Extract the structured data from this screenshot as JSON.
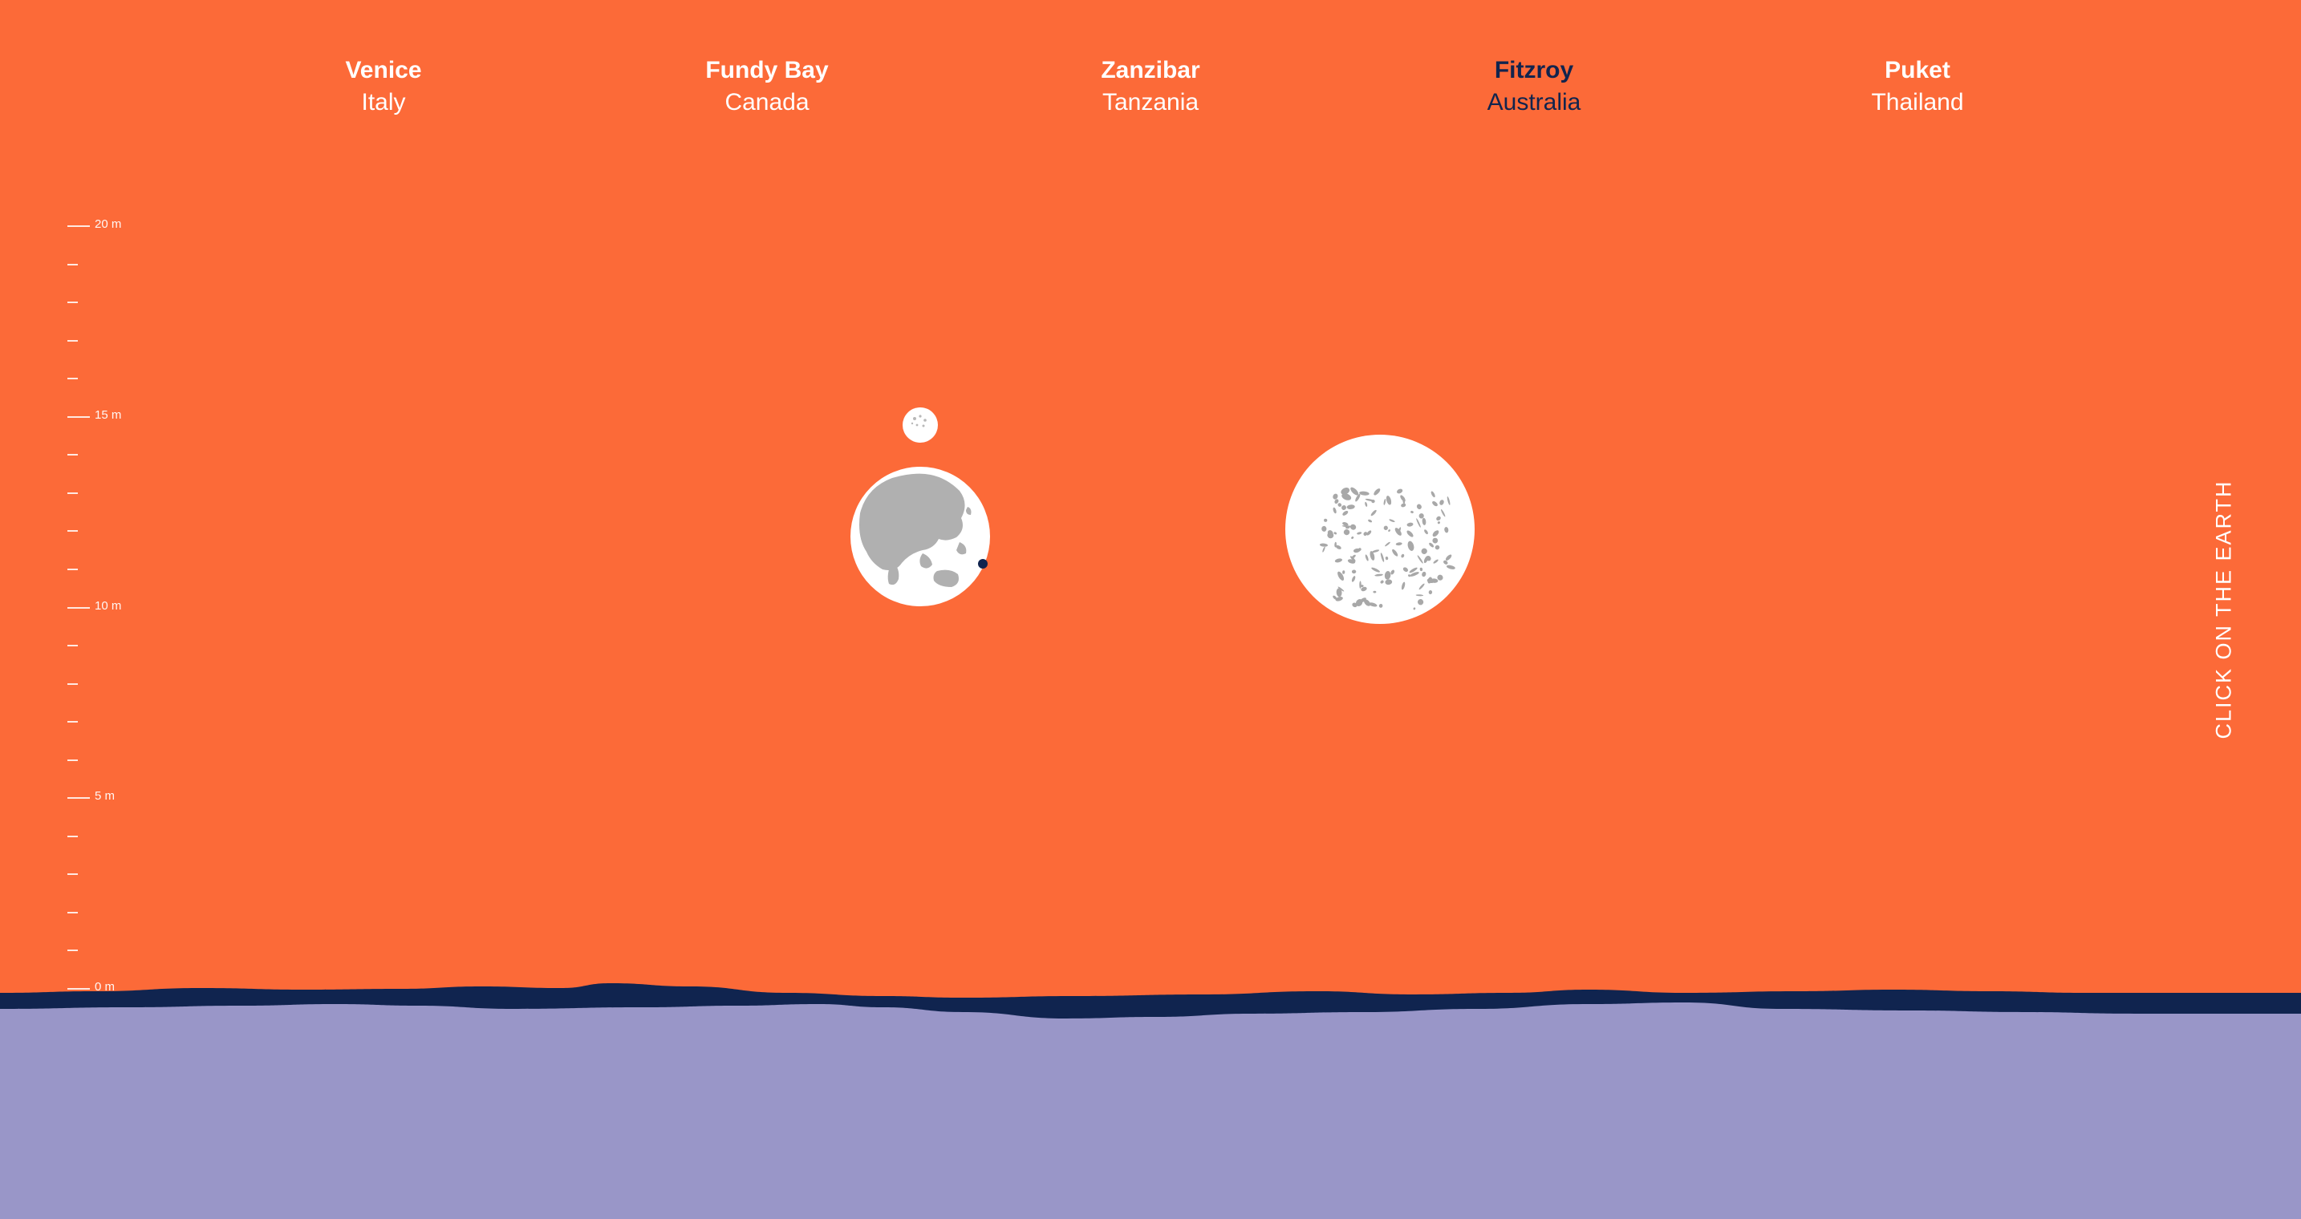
{
  "colors": {
    "background": "#FC6A38",
    "water": "#9996C8",
    "water_band": "#10244F",
    "text_light": "#FFFFFF",
    "text_active": "#11244E",
    "land": "#B0B0B0",
    "body_white": "#FFFFFF"
  },
  "nav": {
    "active_index": 3,
    "items": [
      {
        "city": "Venice",
        "country": "Italy"
      },
      {
        "city": "Fundy Bay",
        "country": "Canada"
      },
      {
        "city": "Zanzibar",
        "country": "Tanzania"
      },
      {
        "city": "Fitzroy",
        "country": "Australia"
      },
      {
        "city": "Puket",
        "country": "Thailand"
      }
    ]
  },
  "scale": {
    "unit": "m",
    "max_m": 20,
    "minor_step_m": 1,
    "labels": [
      "20 m",
      "15 m",
      "10 m",
      "5 m",
      "0 m"
    ]
  },
  "cta": {
    "label": "CLICK ON THE EARTH"
  },
  "bodies": {
    "earth_icon": "earth-globe-icon",
    "moon_small_icon": "small-moon-icon",
    "moon_large_icon": "large-moon-icon",
    "marker_icon": "location-dot-icon"
  }
}
